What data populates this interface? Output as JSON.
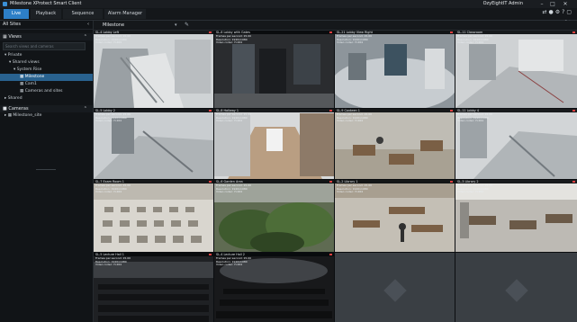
{
  "window": {
    "title": "Milestone XProtect Smart Client",
    "user": "OzyEightIT Admin  ",
    "controls": [
      "–",
      "□",
      "✕"
    ]
  },
  "tabs": [
    {
      "label": "Live"
    },
    {
      "label": "Playback"
    },
    {
      "label": "Sequence Explorer"
    },
    {
      "label": "Alarm Manager"
    }
  ],
  "clock": {
    "line1": "Setup",
    "line2": "2:30 AM"
  },
  "sidebar": {
    "header": "All Sites",
    "views_label": "Views",
    "search_placeholder": "Search views and cameras",
    "tree": [
      "Private",
      "Shared views",
      "System Rise",
      "Milestone",
      "Cam1",
      "Cameras and sites",
      "Shared"
    ],
    "cameras_label": "Cameras",
    "camera_tree": [
      "Milestone_site"
    ]
  },
  "view": {
    "name": "Milestone"
  },
  "cameras": [
    {
      "name": "SL-4 Lobby Left",
      "stats": [
        "Frames per second: 15.00",
        "Resolution: 1920x1080",
        "Video codec: H.264"
      ]
    },
    {
      "name": "SL-8 Lobby with Gates",
      "stats": [
        "Frames per second: 15.00",
        "Resolution: 1920x1080",
        "Video codec: H.264"
      ]
    },
    {
      "name": "SL-21 Lobby View Right",
      "stats": [
        "Frames per second: 15.00",
        "Resolution: 1920x1080",
        "Video codec: H.264"
      ]
    },
    {
      "name": "SL-11 Classroom",
      "stats": [
        "Frames per second: 15.00",
        "Resolution: 1920x1080",
        "Video codec: H.264"
      ]
    },
    {
      "name": "SL-5 Lobby 2",
      "stats": [
        "Frames per second: 15.00",
        "Resolution: 1920x1080",
        "Video codec: H.264"
      ]
    },
    {
      "name": "SL-8 Hallway 1",
      "stats": [
        "Frames per second: 15.00",
        "Resolution: 1920x1080",
        "Video codec: H.264"
      ]
    },
    {
      "name": "SL-9 Canteen 1",
      "stats": [
        "Frames per second: 15.00",
        "Resolution: 1920x1080",
        "Video codec: H.264"
      ]
    },
    {
      "name": "SL-11 Lobby 4",
      "stats": [
        "Frames per second: 15.00",
        "Resolution: 1920x1080",
        "Video codec: H.264"
      ]
    },
    {
      "name": "SL-7 Exam Room 1",
      "stats": [
        "Frames per second: 15.00",
        "Resolution: 1920x1080",
        "Video codec: H.264"
      ]
    },
    {
      "name": "SL-6 Garden Area",
      "stats": [
        "Frames per second: 15.00",
        "Resolution: 1920x1080",
        "Video codec: H.264"
      ]
    },
    {
      "name": "SL-2 Library 1",
      "stats": [
        "Frames per second: 15.00",
        "Resolution: 1920x1080",
        "Video codec: H.264"
      ]
    },
    {
      "name": "SL-3 Library 2",
      "stats": [
        "Frames per second: 15.00",
        "Resolution: 1920x1080",
        "Video codec: H.264"
      ]
    },
    {
      "name": "SL-5 Lecture Hall 1",
      "stats": [
        "Frames per second: 15.00",
        "Resolution: 1920x1080",
        "Video codec: H.264"
      ]
    },
    {
      "name": "SL-4 Lecture Hall 2",
      "stats": [
        "Frames per second: 15.00",
        "Resolution: 1920x1080",
        "Video codec: H.264"
      ]
    }
  ],
  "colors": {
    "accent": "#2d7fc7",
    "selected": "#29628f",
    "alert": "#e04040"
  }
}
